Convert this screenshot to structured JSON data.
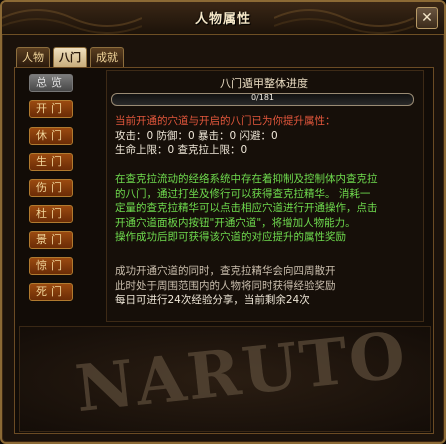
{
  "window": {
    "title": "人物属性",
    "close_label": "✕"
  },
  "tabs": [
    {
      "label": "人物",
      "active": false
    },
    {
      "label": "八门",
      "active": true
    },
    {
      "label": "成就",
      "active": false
    }
  ],
  "sidebar": {
    "overview": "总览",
    "gates": [
      "开门",
      "休门",
      "生门",
      "伤门",
      "杜门",
      "景门",
      "惊门",
      "死门"
    ]
  },
  "progress": {
    "title": "八门遁甲整体进度",
    "text": "0/181",
    "value": 0
  },
  "attributes": {
    "heading": "当前开通的穴道与开启的八门已为你提升属性：",
    "line1": "攻击：0 防御：0 暴击：0 闪避：0",
    "line2": "生命上限：0 查克拉上限：0"
  },
  "description": [
    "在查克拉流动的经络系统中存在着抑制及控制体内查克拉",
    "的八门，通过打坐及修行可以获得查克拉精华。 消耗一",
    "定量的查克拉精华可以点击相应穴道进行开通操作，点击",
    "开通穴道面板内按钮\"开通穴道\"，将增加人物能力。",
    "操作成功后即可获得该穴道的对应提升的属性奖励"
  ],
  "sharing": [
    "成功开通穴道的同时，查克拉精华会向四周散开",
    "此时处于周围范围内的人物将同时获得经验奖励",
    "每日可进行24次经验分享，当前剩余24次"
  ],
  "logo_text": "NARUTO",
  "colors": {
    "accent": "#e4573c",
    "green_text": "#6fdc4e",
    "button": "#8a3d0c"
  }
}
